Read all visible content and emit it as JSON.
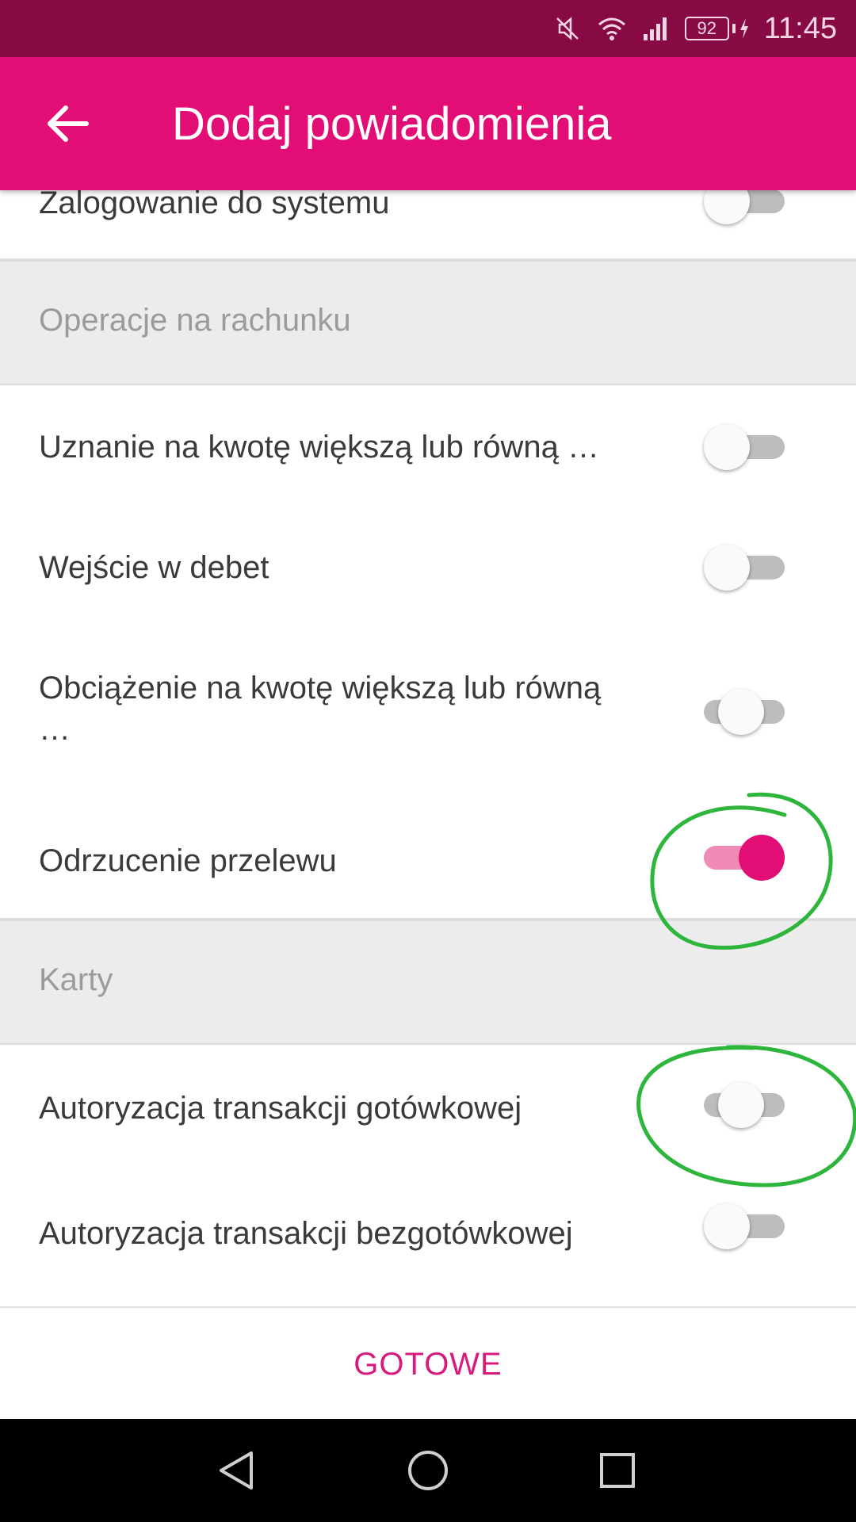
{
  "status_bar": {
    "battery": "92",
    "time": "11:45"
  },
  "header": {
    "title": "Dodaj powiadomienia"
  },
  "rows": {
    "login": {
      "label": "Zalogowanie do systemu",
      "enabled": false
    },
    "credit": {
      "label": "Uznanie na kwotę większą lub równą …",
      "enabled": false
    },
    "debit_entry": {
      "label": "Wejście w debet",
      "enabled": false
    },
    "charge": {
      "label": "Obciążenie na kwotę większą lub równą …",
      "enabled": false
    },
    "transfer_rejection": {
      "label": "Odrzucenie przelewu",
      "enabled": true
    },
    "cash_auth": {
      "label": "Autoryzacja transakcji gotówkowej",
      "enabled": false
    },
    "cashless_auth": {
      "label": "Autoryzacja transakcji bezgotówkowej",
      "enabled": false
    }
  },
  "sections": {
    "account": "Operacje na rachunku",
    "cards": "Karty"
  },
  "footer": {
    "done_label": "GOTOWE"
  },
  "colors": {
    "brand": "#e20e75",
    "status_bar": "#880a45",
    "annotation": "#2db53c"
  }
}
